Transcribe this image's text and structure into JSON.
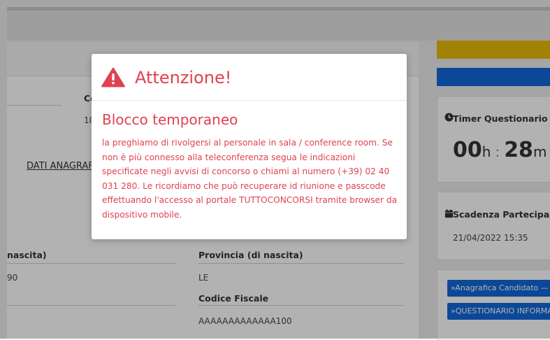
{
  "background": {
    "field_label_partial": "Co",
    "field_value_partial": "10",
    "section_link": "DATI ANAGRAFICI",
    "birth_field_label": "nascita)",
    "birth_field_value": "90",
    "province_label": "Provincia (di nascita)",
    "province_value": "LE",
    "fiscal_code_label": "Codice Fiscale",
    "fiscal_code_value": "AAAAAAAAAAAAA100"
  },
  "sidebar": {
    "timer_title": "Timer Questionario",
    "timer_hours": "00",
    "timer_hours_unit": "h",
    "timer_separator": ":",
    "timer_minutes": "28",
    "timer_minutes_unit": "m",
    "deadline_title": "Scadenza Partecipazione",
    "deadline_value": "21/04/2022 15:35",
    "btn_anagrafica": "»Anagrafica Candidato —",
    "btn_questionario": "»QUESTIONARIO INFORMATIVO",
    "colors": {
      "yellow": "#e8bb08",
      "blue": "#1167d8"
    }
  },
  "modal": {
    "title": "Attenzione!",
    "subtitle": "Blocco temporaneo",
    "message": "la preghiamo di rivolgersi al personale in sala / conference room. Se non è più connesso alla teleconferenza segua le indicazioni specificate negli avvisi di concorso o chiami al numero (+39) 02 40 031 280. Le ricordiamo che può recuperare id riunione e passcode effettuando l'accesso al portale TUTTOCONCORSI tramite browser da dispositivo mobile.",
    "icon": "warning-triangle-icon",
    "accent_color": "#e0414f"
  }
}
